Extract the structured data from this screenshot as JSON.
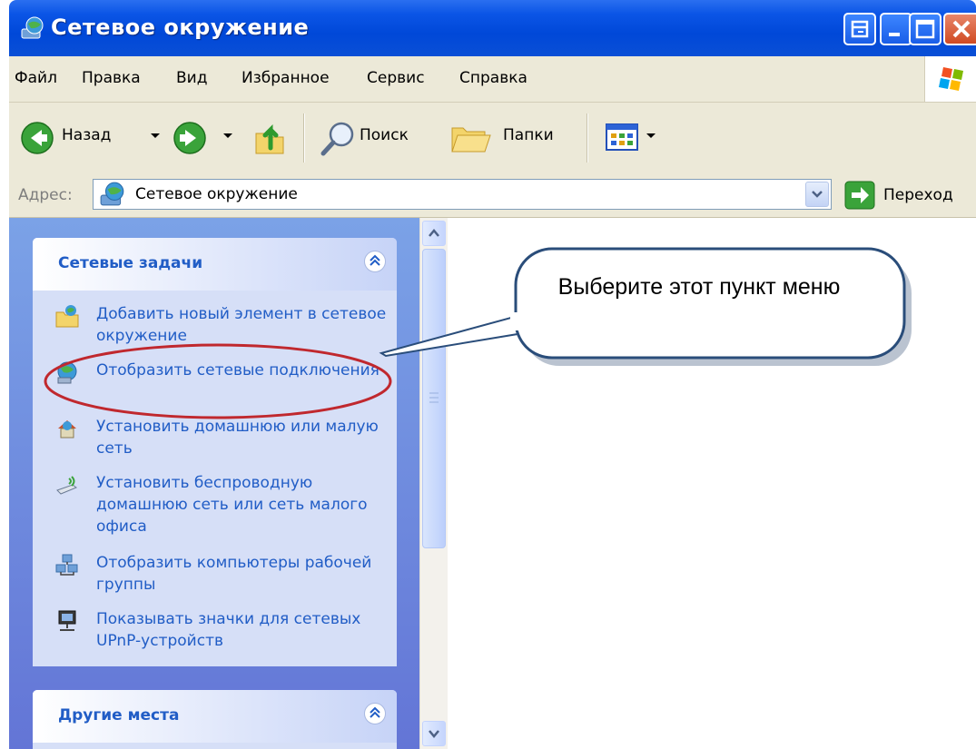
{
  "window": {
    "title": "Сетевое окружение",
    "buttons": [
      "help-button",
      "minimize-button",
      "maximize-button",
      "close-button"
    ]
  },
  "menubar": {
    "items": [
      "Файл",
      "Правка",
      "Вид",
      "Избранное",
      "Сервис",
      "Справка"
    ]
  },
  "toolbar": {
    "back_label": "Назад",
    "search_label": "Поиск",
    "folders_label": "Папки"
  },
  "address": {
    "label": "Адрес:",
    "value": "Сетевое окружение",
    "go_label": "Переход"
  },
  "network_tasks": {
    "title": "Сетевые задачи",
    "items": [
      {
        "icon": "add-network-place-icon",
        "label": "Добавить новый элемент в сетевое окружение"
      },
      {
        "icon": "network-connections-icon",
        "label": "Отобразить сетевые подключения"
      },
      {
        "icon": "home-network-icon",
        "label": "Установить домашнюю или малую сеть"
      },
      {
        "icon": "wireless-network-icon",
        "label": "Установить беспроводную домашнюю сеть или сеть малого офиса"
      },
      {
        "icon": "workgroup-computers-icon",
        "label": "Отобразить компьютеры рабочей группы"
      },
      {
        "icon": "upnp-devices-icon",
        "label": "Показывать значки для сетевых UPnP-устройств"
      }
    ]
  },
  "other_places": {
    "title": "Другие места"
  },
  "annotation": {
    "callout_text": "Выберите этот пункт меню"
  },
  "colors": {
    "titlebar": "#0a4fd6",
    "task_link": "#215dc6",
    "panel_bg": "#d6dff7",
    "highlight_ring": "#c0282e"
  }
}
